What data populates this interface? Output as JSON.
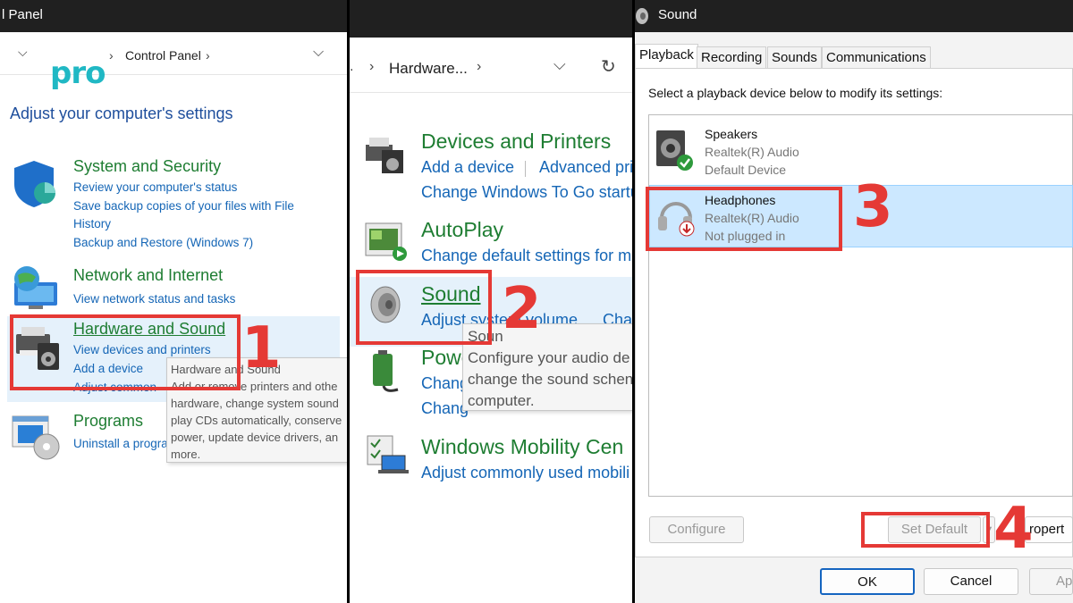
{
  "panel1": {
    "window_title": "l Panel",
    "breadcrumb": "Control Panel",
    "logo_text": "pro",
    "heading": "Adjust your computer's settings",
    "categories": [
      {
        "title": "System and Security",
        "links": [
          "Review your computer's status",
          "Save backup copies of your files with File",
          "History",
          "Backup and Restore (Windows 7)"
        ]
      },
      {
        "title": "Network and Internet",
        "links": [
          "View network status and tasks"
        ]
      },
      {
        "title": "Hardware and Sound",
        "links": [
          "View devices and printers",
          "Add a device",
          "Adjust common"
        ]
      },
      {
        "title": "Programs",
        "links": [
          "Uninstall a progra"
        ]
      }
    ],
    "tooltip": {
      "title": "Hardware and Sound",
      "lines": [
        "Add or remove printers and othe",
        "hardware, change system sound",
        "play CDs automatically, conserve",
        "power, update device drivers, an",
        "more."
      ]
    },
    "step": "1"
  },
  "panel2": {
    "breadcrumb": "Hardware...",
    "categories": [
      {
        "title": "Devices and Printers",
        "links": [
          "Add a device",
          "Advanced pri",
          "Change Windows To Go startu"
        ]
      },
      {
        "title": "AutoPlay",
        "links": [
          "Change default settings for me"
        ]
      },
      {
        "title": "Sound",
        "links": [
          "Adjust system volume",
          "Cha"
        ]
      },
      {
        "title": "Powe",
        "links": [
          "Chang",
          "Chang"
        ]
      },
      {
        "title": "Windows Mobility Cen",
        "links": [
          "Adjust commonly used mobili"
        ]
      }
    ],
    "tooltip": {
      "title": "Soun",
      "lines": [
        "Configure your audio de",
        "change the sound schen",
        "computer."
      ]
    },
    "step": "2"
  },
  "panel3": {
    "window_title": "Sound",
    "tabs": [
      "Playback",
      "Recording",
      "Sounds",
      "Communications"
    ],
    "instruction": "Select a playback device below to modify its settings:",
    "devices": [
      {
        "name": "Speakers",
        "driver": "Realtek(R) Audio",
        "status": "Default Device"
      },
      {
        "name": "Headphones",
        "driver": "Realtek(R) Audio",
        "status": "Not plugged in"
      }
    ],
    "buttons": {
      "configure": "Configure",
      "set_default": "Set Default",
      "properties": "ropert",
      "ok": "OK",
      "cancel": "Cancel",
      "apply": "Ap"
    },
    "step3": "3",
    "step4": "4"
  }
}
